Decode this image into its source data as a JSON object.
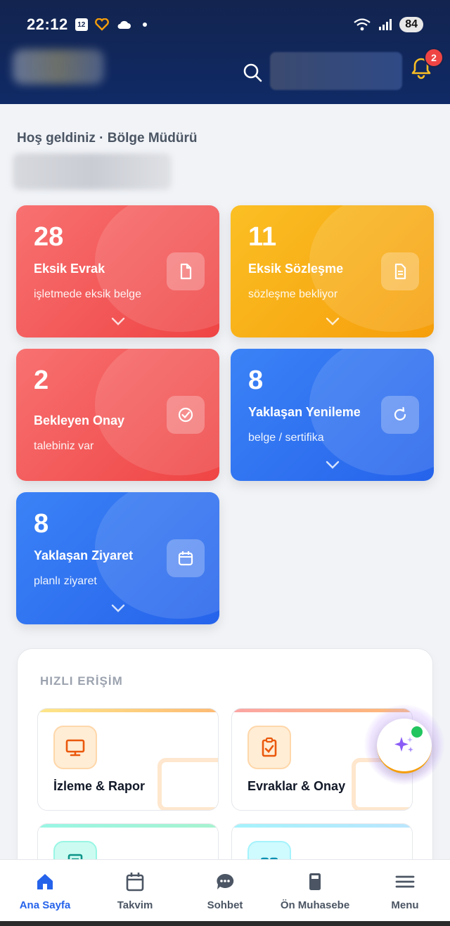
{
  "status_bar": {
    "time": "22:12",
    "calendar_day": "12",
    "battery": "84"
  },
  "header": {
    "notification_count": "2"
  },
  "welcome": {
    "text": "Hoş geldiniz · Bölge Müdürü"
  },
  "cards": [
    {
      "number": "28",
      "title": "Eksik Evrak",
      "subtitle": "işletmede eksik belge",
      "icon": "document-icon",
      "color": "red"
    },
    {
      "number": "11",
      "title": "Eksik Sözleşme",
      "subtitle": "sözleşme bekliyor",
      "icon": "contract-icon",
      "color": "yellow"
    },
    {
      "number": "2",
      "title": "Bekleyen Onay",
      "subtitle": "talebiniz var",
      "icon": "check-circle-icon",
      "color": "red"
    },
    {
      "number": "8",
      "title": "Yaklaşan Yenileme",
      "subtitle": "belge / sertifika",
      "icon": "refresh-icon",
      "color": "blue"
    },
    {
      "number": "8",
      "title": "Yaklaşan Ziyaret",
      "subtitle": "planlı ziyaret",
      "icon": "calendar-icon",
      "color": "blue"
    }
  ],
  "quick_access": {
    "title": "HIZLI ERİŞİM",
    "items": [
      {
        "label": "İzleme & Rapor",
        "icon": "monitor-icon",
        "color": "#ea580c"
      },
      {
        "label": "Evraklar & Onay",
        "icon": "clipboard-check-icon",
        "color": "#ea580c"
      },
      {
        "label": "",
        "icon": "calculator-icon",
        "color": "#0d9488"
      },
      {
        "label": "",
        "icon": "grid-icon",
        "color": "#0891b2"
      }
    ]
  },
  "bottom_nav": [
    {
      "label": "Ana Sayfa",
      "icon": "home-icon",
      "active": true
    },
    {
      "label": "Takvim",
      "icon": "calendar-icon",
      "active": false
    },
    {
      "label": "Sohbet",
      "icon": "chat-icon",
      "active": false
    },
    {
      "label": "Ön Muhasebe",
      "icon": "accounting-icon",
      "active": false
    },
    {
      "label": "Menu",
      "icon": "menu-icon",
      "active": false
    }
  ],
  "colors": {
    "header_bg": "#13244f",
    "accent": "#2563eb",
    "red": "#ef4444",
    "yellow": "#f59e0b",
    "blue": "#2563eb",
    "ai_fab": "#8b5cf6",
    "online": "#22c55e"
  }
}
